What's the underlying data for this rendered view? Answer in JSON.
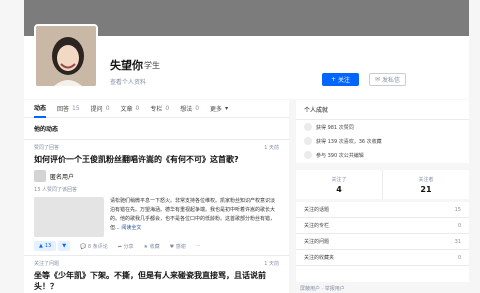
{
  "profile": {
    "name": "失望你",
    "headline": "学生",
    "detail_link": "查看个人资料",
    "follow_label": "关注",
    "message_label": "发私信"
  },
  "tabs": [
    {
      "label": "动态",
      "count": ""
    },
    {
      "label": "回答",
      "count": "15"
    },
    {
      "label": "提问",
      "count": "0"
    },
    {
      "label": "文章",
      "count": "0"
    },
    {
      "label": "专栏",
      "count": "0"
    },
    {
      "label": "想法",
      "count": "0"
    },
    {
      "label": "更多",
      "count": ""
    }
  ],
  "section_title": "他的动态",
  "feed": [
    {
      "meta": "赞同了回答",
      "time": "1 天前",
      "title": "如何评价一个王俊凯粉丝翻唱许嵩的《有何不可》这首歌?",
      "author": "匿名用户",
      "agree": "13 人赞同了该回答",
      "excerpt": "请松驰们稍微平息一下怒火。非常支持各位维权。凯家粉丝知识产权意识淡泊有错在先。万望海涵。德华有重视起争端。我也是初中听着许嵩的歌长大的。他的歌我几乎都会，也不是各位口中的低龄粉。这首歌部分粉丝有错，但...",
      "read_more": "阅读全文",
      "vote": "13",
      "comments": "8 条评论",
      "share": "分享",
      "collect": "收藏",
      "thanks": "感谢"
    },
    {
      "meta": "关注了问题",
      "time": "1 天前",
      "title": "坐等《少年凯》下架。不撕，但是有人来碰瓷我直接骂，且话说前头！？"
    }
  ],
  "achievements": {
    "title": "个人成就",
    "rows": [
      "获得 981 次赞同",
      "获得 139 次喜欢，36 次收藏",
      "参与 390 次公共编辑"
    ]
  },
  "follow_stats": {
    "following_label": "关注了",
    "following": "4",
    "followers_label": "关注者",
    "followers": "21"
  },
  "side_list": [
    {
      "label": "关注的话题",
      "count": "15"
    },
    {
      "label": "关注的专栏",
      "count": "0"
    },
    {
      "label": "关注的问题",
      "count": "31"
    },
    {
      "label": "关注的收藏夹",
      "count": "0"
    }
  ],
  "footer": "屏蔽用户 · 举报用户"
}
